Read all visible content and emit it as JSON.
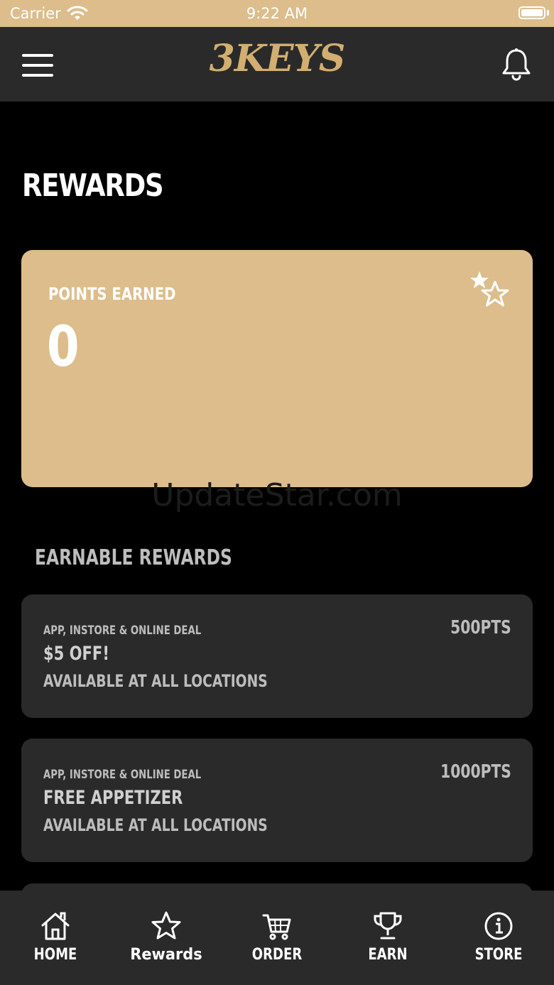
{
  "status_bar": {
    "carrier": "Carrier",
    "time": "9:22 AM"
  },
  "header": {
    "logo_text": "3KEYS"
  },
  "page": {
    "title": "REWARDS"
  },
  "points_card": {
    "label": "POINTS EARNED",
    "value": "0"
  },
  "watermark": "UpdateStar.com",
  "earnable": {
    "title": "EARNABLE REWARDS",
    "items": [
      {
        "deal_type": "APP, INSTORE & ONLINE DEAL",
        "name": "$5 OFF!",
        "availability": "AVAILABLE AT ALL LOCATIONS",
        "points": "500PTS"
      },
      {
        "deal_type": "APP, INSTORE & ONLINE DEAL",
        "name": "FREE APPETIZER",
        "availability": "AVAILABLE AT ALL LOCATIONS",
        "points": "1000PTS"
      }
    ]
  },
  "tabs": [
    {
      "label": "HOME",
      "icon": "home-icon"
    },
    {
      "label": "Rewards",
      "icon": "star-icon",
      "active": true
    },
    {
      "label": "ORDER",
      "icon": "cart-icon"
    },
    {
      "label": "EARN",
      "icon": "trophy-icon"
    },
    {
      "label": "STORE",
      "icon": "info-icon"
    }
  ],
  "colors": {
    "accent": "#dcbd8b",
    "surface": "#2a2a2a",
    "background": "#000000",
    "logo": "#d2ae70"
  }
}
